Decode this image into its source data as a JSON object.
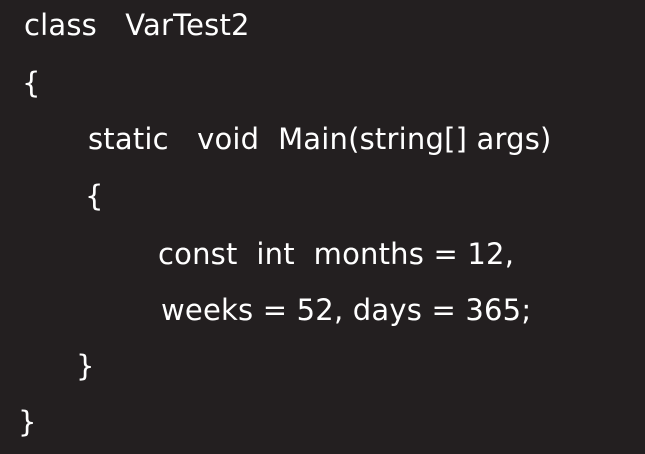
{
  "code": {
    "lines": [
      "class   VarTest2",
      "{",
      "static   void  Main(string[] args)",
      "{",
      "const  int  months = 12,",
      "weeks = 52, days = 365;",
      "}",
      "}"
    ]
  },
  "colors": {
    "background": "#231f20",
    "text": "#ffffff"
  }
}
